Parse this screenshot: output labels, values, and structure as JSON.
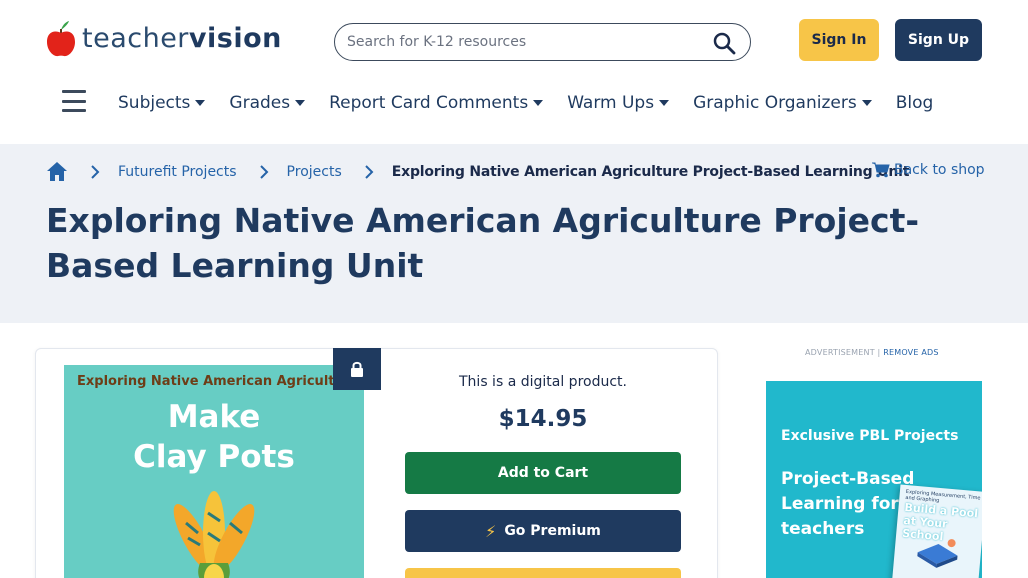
{
  "brand": {
    "logo_light": "teacher",
    "logo_bold": "vision"
  },
  "header": {
    "search_placeholder": "Search for K-12 resources",
    "sign_in": "Sign In",
    "sign_up": "Sign Up"
  },
  "nav": {
    "items": [
      {
        "label": "Subjects",
        "dropdown": true
      },
      {
        "label": "Grades",
        "dropdown": true
      },
      {
        "label": "Report Card Comments",
        "dropdown": true
      },
      {
        "label": "Warm Ups",
        "dropdown": true
      },
      {
        "label": "Graphic Organizers",
        "dropdown": true
      },
      {
        "label": "Blog",
        "dropdown": false
      }
    ]
  },
  "breadcrumb": {
    "items": [
      "Futurefit Projects",
      "Projects"
    ],
    "current": "Exploring Native American Agriculture Project-Based Learning Unit",
    "back_link": "Back to shop"
  },
  "page": {
    "title": "Exploring Native American Agriculture Project-Based Learning Unit"
  },
  "product": {
    "cover_subtitle": "Exploring Native American Agriculture",
    "cover_title_line1": "Make",
    "cover_title_line2": "Clay Pots",
    "digital_note": "This is a digital product.",
    "price": "$14.95",
    "add_to_cart": "Add to Cart",
    "go_premium": "Go Premium",
    "bolt_icon": "lightning-bolt-icon",
    "lock_icon": "lock-icon"
  },
  "ad": {
    "label": "ADVERTISEMENT |",
    "remove": "REMOVE ADS",
    "headline": "Exclusive PBL Projects",
    "subheadline": "Project-Based Learning for busy teachers",
    "book_small": "Exploring Measurement, Time and Graphing",
    "book_big": "Build a Pool at Your School"
  },
  "colors": {
    "navy": "#1f3a5f",
    "yellow": "#f7c548",
    "green": "#157a45",
    "link": "#2563a8",
    "hero_bg": "#eef1f6",
    "cover_teal": "#67cdc4",
    "ad_teal": "#21b8cc"
  }
}
